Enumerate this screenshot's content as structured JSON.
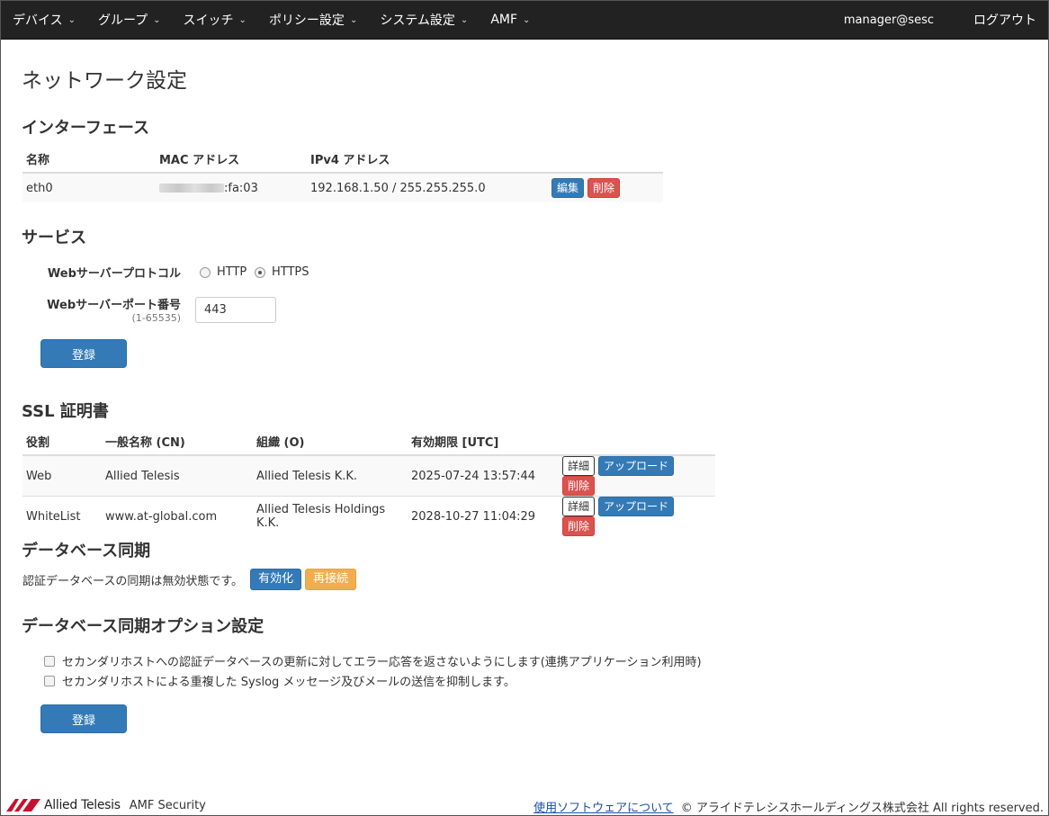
{
  "nav": {
    "items": [
      "デバイス",
      "グループ",
      "スイッチ",
      "ポリシー設定",
      "システム設定",
      "AMF"
    ],
    "user": "manager@sesc",
    "logout": "ログアウト"
  },
  "page": {
    "title": "ネットワーク設定"
  },
  "interface": {
    "title": "インターフェース",
    "headers": [
      "名称",
      "MAC アドレス",
      "IPv4 アドレス"
    ],
    "rows": [
      {
        "name": "eth0",
        "mac_suffix": ":fa:03",
        "ipv4": "192.168.1.50 / 255.255.255.0",
        "edit": "編集",
        "delete": "削除"
      }
    ]
  },
  "service": {
    "title": "サービス",
    "protocol_label": "Webサーバープロトコル",
    "protocol_options": [
      "HTTP",
      "HTTPS"
    ],
    "protocol_selected": "HTTPS",
    "port_label": "Webサーバーポート番号",
    "port_range": "(1-65535)",
    "port_value": "443",
    "submit": "登録"
  },
  "ssl": {
    "title": "SSL 証明書",
    "headers": [
      "役割",
      "一般名称 (CN)",
      "組織 (O)",
      "有効期限 [UTC]"
    ],
    "rows": [
      {
        "role": "Web",
        "cn": "Allied Telesis",
        "org": "Allied Telesis K.K.",
        "expiry": "2025-07-24 13:57:44"
      },
      {
        "role": "WhiteList",
        "cn": "www.at-global.com",
        "org": "Allied Telesis Holdings K.K.",
        "expiry": "2028-10-27 11:04:29"
      }
    ],
    "detail": "詳細",
    "upload": "アップロード",
    "delete": "削除"
  },
  "dbsync": {
    "title": "データベース同期",
    "status_text": "認証データベースの同期は無効状態です。",
    "enable": "有効化",
    "reconnect": "再接続"
  },
  "dbsync_options": {
    "title": "データベース同期オプション設定",
    "options": [
      "セカンダリホストへの認証データベースの更新に対してエラー応答を返さないようにします(連携アプリケーション利用時)",
      "セカンダリホストによる重複した Syslog メッセージ及びメールの送信を抑制します。"
    ],
    "submit": "登録"
  },
  "footer": {
    "brand": "Allied Telesis",
    "product": "AMF Security",
    "link": "使用ソフトウェアについて",
    "copyright": "© アライドテレシスホールディングス株式会社 All rights reserved."
  },
  "colors": {
    "navbar": "#222222",
    "primary": "#337ab7",
    "danger": "#d9534f",
    "warning": "#f0ad4e",
    "logo_red": "#c8102e"
  }
}
